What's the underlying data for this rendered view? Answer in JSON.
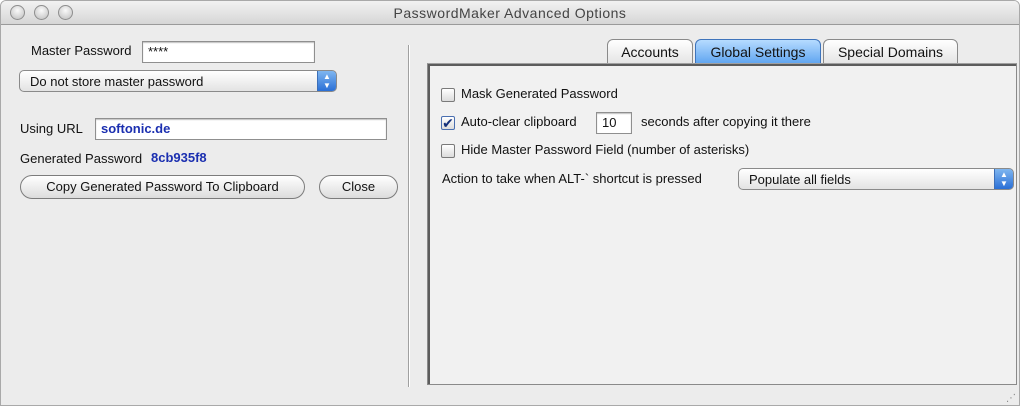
{
  "window": {
    "title": "PasswordMaker Advanced Options"
  },
  "left": {
    "master_password_label": "Master Password",
    "master_password_value": "****",
    "store_select_value": "Do not store master password",
    "using_url_label": "Using URL",
    "using_url_value": "softonic.de",
    "generated_label": "Generated Password",
    "generated_value": "8cb935f8",
    "copy_button": "Copy Generated Password To Clipboard",
    "close_button": "Close"
  },
  "tabs": [
    {
      "label": "Accounts",
      "active": false
    },
    {
      "label": "Global Settings",
      "active": true
    },
    {
      "label": "Special Domains",
      "active": false
    }
  ],
  "global_settings": {
    "mask_label": "Mask Generated Password",
    "mask_checked": false,
    "autoclear_label": "Auto-clear clipboard",
    "autoclear_checked": true,
    "autoclear_value": "10",
    "autoclear_suffix": "seconds after copying it there",
    "hide_master_label": "Hide Master Password Field (number of asterisks)",
    "hide_master_checked": false,
    "shortcut_label": "Action to take when ALT-` shortcut is pressed",
    "shortcut_value": "Populate all fields"
  },
  "icons": {
    "checkmark": "✔",
    "popup_arrows": "▲▼",
    "resize_grip": "⋰"
  }
}
